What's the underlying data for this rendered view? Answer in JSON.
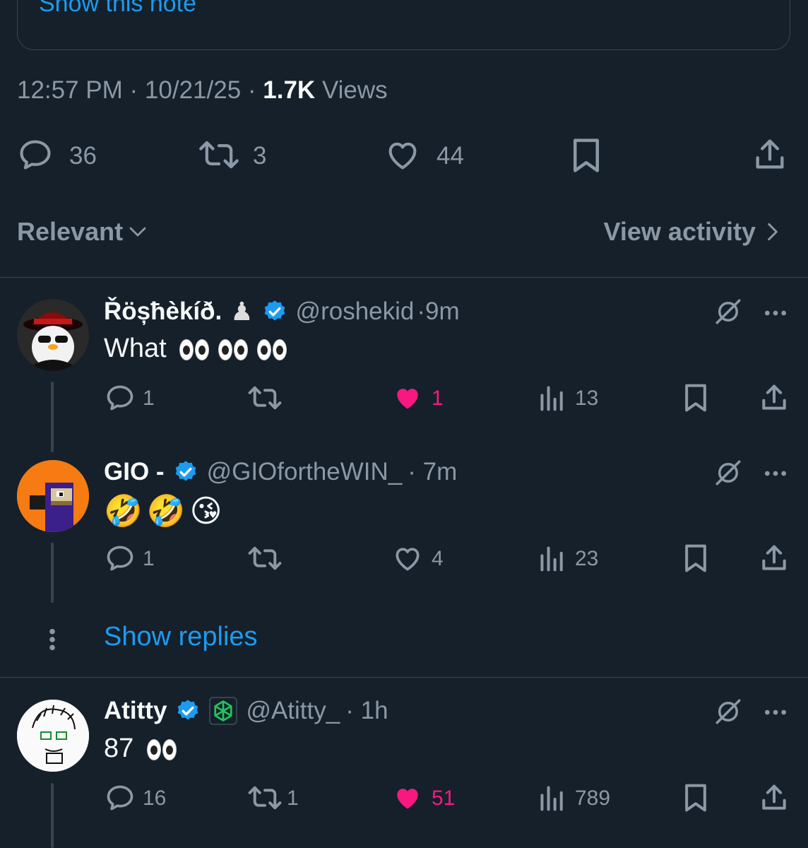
{
  "note": {
    "link_label": "Show this note"
  },
  "meta": {
    "time": "12:57 PM",
    "sep1": " · ",
    "date": "10/21/25",
    "sep2": " · ",
    "views_count": "1.7K",
    "views_label": " Views"
  },
  "actions": {
    "replies": "36",
    "reposts": "3",
    "likes": "44"
  },
  "sort": {
    "label": "Relevant",
    "view_activity": "View activity"
  },
  "replies": [
    {
      "name": "Řöșħèkíð.",
      "handle": "@roshekid",
      "time": "·9m",
      "text": "What",
      "emoji_count": 3,
      "replies": "1",
      "reposts": "",
      "likes": "1",
      "liked": true,
      "views": "13"
    },
    {
      "name": "GIO -",
      "handle": "@GIOfortheWIN_",
      "time": "· 7m",
      "text": "🤣🤣😘",
      "replies": "1",
      "reposts": "",
      "likes": "4",
      "liked": false,
      "views": "23"
    },
    {
      "name": "Atitty",
      "handle": "@Atitty_",
      "time": "· 1h",
      "text": "87",
      "emoji_count": 1,
      "replies": "16",
      "reposts": "1",
      "likes": "51",
      "liked": true,
      "views": "789"
    }
  ],
  "show_replies": "Show replies",
  "colors": {
    "background": "#15202b",
    "accent": "#1d9bf0",
    "like": "#f91880",
    "muted": "#8b98a5"
  }
}
